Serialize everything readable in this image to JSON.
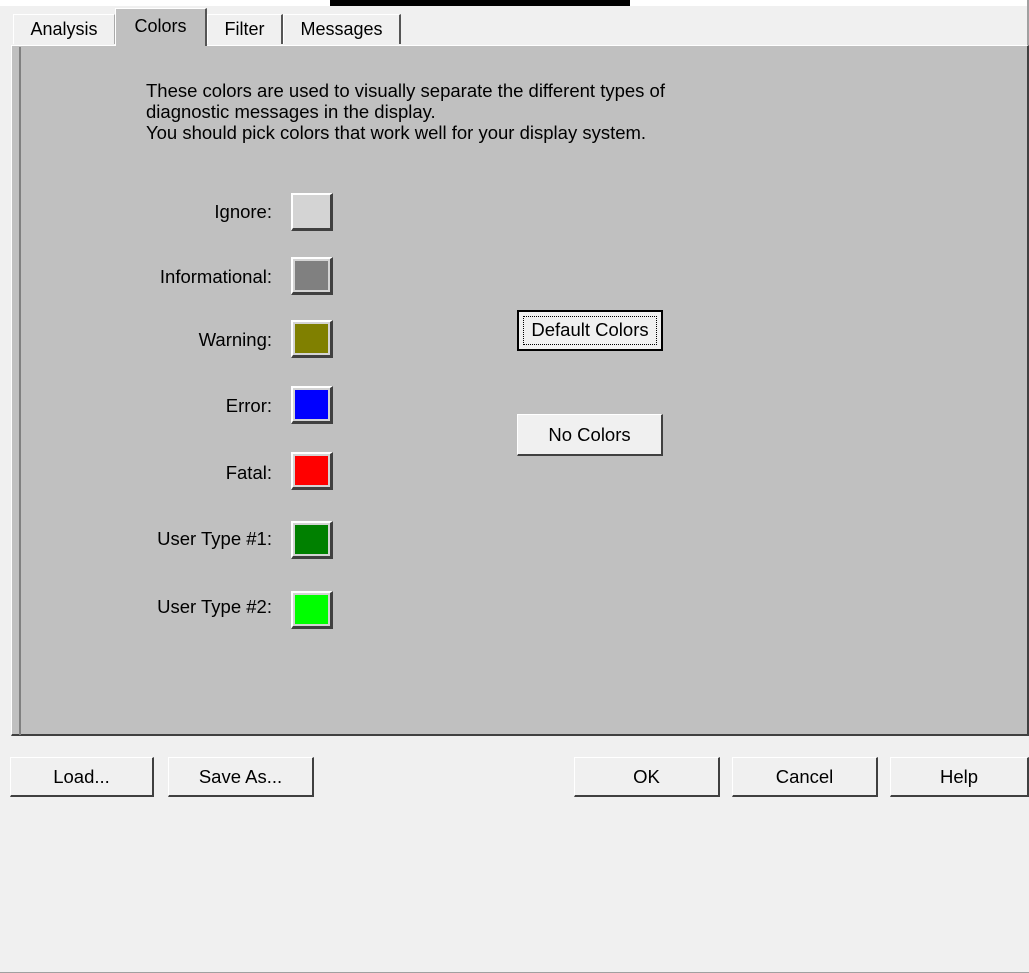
{
  "tabs": [
    {
      "label": "Analysis",
      "active": false
    },
    {
      "label": "Colors",
      "active": true
    },
    {
      "label": "Filter",
      "active": false
    },
    {
      "label": "Messages",
      "active": false
    }
  ],
  "description": [
    "These colors are used to visually separate the different types of",
    "diagnostic messages in the display.",
    "You should pick colors that work well for your display system."
  ],
  "color_rows": [
    {
      "label": "Ignore:",
      "color": "#d4d4d4",
      "icon": "color-swatch"
    },
    {
      "label": "Informational:",
      "color": "#808080",
      "icon": "color-swatch"
    },
    {
      "label": "Warning:",
      "color": "#808000",
      "icon": "color-swatch"
    },
    {
      "label": "Error:",
      "color": "#0000ff",
      "icon": "color-swatch"
    },
    {
      "label": "Fatal:",
      "color": "#ff0000",
      "icon": "color-swatch"
    },
    {
      "label": "User Type #1:",
      "color": "#008000",
      "icon": "color-swatch"
    },
    {
      "label": "User Type #2:",
      "color": "#00ff00",
      "icon": "color-swatch"
    }
  ],
  "buttons": {
    "default_colors": "Default Colors",
    "no_colors": "No Colors"
  },
  "footer": {
    "load": "Load...",
    "save_as": "Save As...",
    "ok": "OK",
    "cancel": "Cancel",
    "help": "Help"
  },
  "theme": {
    "panel_bg": "#c0c0c0",
    "window_bg": "#f0f0f0"
  }
}
